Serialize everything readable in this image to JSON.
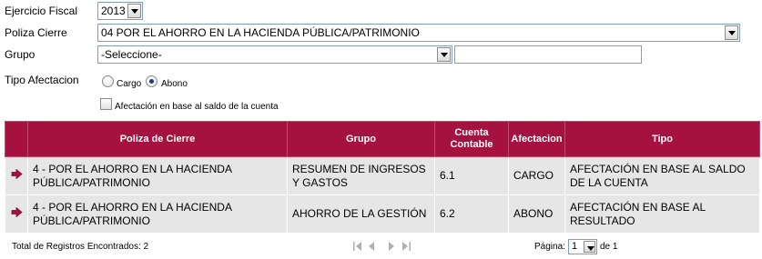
{
  "filters": {
    "ejercicio_label": "Ejercicio Fiscal",
    "ejercicio_value": "2013",
    "poliza_label": "Poliza Cierre",
    "poliza_value": "04 POR EL AHORRO EN LA HACIENDA PÚBLICA/PATRIMONIO",
    "grupo_label": "Grupo",
    "grupo_value": "-Seleccione-",
    "grupo_text": "",
    "tipo_label": "Tipo Afectacion",
    "radio_cargo": "Cargo",
    "radio_abono": "Abono",
    "selected_radio": "Abono",
    "checkbox_label": "Afectación en base al saldo de la cuenta",
    "checkbox_checked": false
  },
  "table": {
    "headers": [
      "",
      "Poliza de Cierre",
      "Grupo",
      "Cuenta Contable",
      "Afectacion",
      "Tipo"
    ],
    "rows": [
      {
        "poliza": "4 - POR EL AHORRO EN LA HACIENDA PÚBLICA/PATRIMONIO",
        "grupo": "RESUMEN DE INGRESOS Y GASTOS",
        "cuenta": "6.1",
        "afectacion": "CARGO",
        "tipo": "AFECTACIÓN EN BASE AL SALDO DE LA CUENTA"
      },
      {
        "poliza": "4 - POR EL AHORRO EN LA HACIENDA PÚBLICA/PATRIMONIO",
        "grupo": "AHORRO DE LA GESTIÓN",
        "cuenta": "6.2",
        "afectacion": "ABONO",
        "tipo": "AFECTACIÓN EN BASE AL RESULTADO"
      }
    ]
  },
  "footer": {
    "total_text": "Total de Registros Encontrados: 2",
    "pagina_label": "Página:",
    "page_value": "1",
    "of_text": "de 1"
  },
  "colors": {
    "header_bg": "#a5123f",
    "row_bg": "#e6e6e6",
    "pointer": "#a5123f"
  },
  "icons": [
    "select-arrow-icon",
    "row-pointer-icon",
    "first-page-icon",
    "prev-page-icon",
    "next-page-icon",
    "last-page-icon"
  ]
}
